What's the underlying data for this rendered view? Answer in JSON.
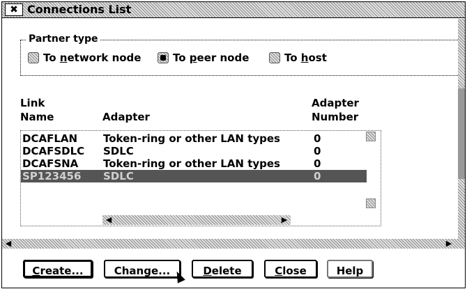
{
  "window": {
    "title": "Connections List",
    "sysmenu_glyph": "✖"
  },
  "partner_type": {
    "label": "Partner type",
    "options": [
      {
        "before": "To ",
        "ul": "n",
        "after": "etwork node",
        "selected": false
      },
      {
        "before": "To ",
        "ul": "p",
        "after": "eer node",
        "selected": true
      },
      {
        "before": "To ",
        "ul": "h",
        "after": "ost",
        "selected": false
      }
    ]
  },
  "columns": {
    "link_line1": "Link",
    "link_line2": "Name",
    "adapter": "Adapter",
    "adapter_num_line1": "Adapter",
    "adapter_num_line2": "Number"
  },
  "rows": [
    {
      "name": "DCAFLAN",
      "adapter": "Token-ring or other LAN types",
      "number": "0",
      "selected": false
    },
    {
      "name": "DCAFSDLC",
      "adapter": "SDLC",
      "number": "0",
      "selected": false
    },
    {
      "name": "DCAFSNA",
      "adapter": "Token-ring or other LAN types",
      "number": "0",
      "selected": false
    },
    {
      "name": "SP123456",
      "adapter": "SDLC",
      "number": "0",
      "selected": true
    }
  ],
  "buttons": {
    "create": {
      "ul": "C",
      "rest": "reate..."
    },
    "change": {
      "label": "Change..."
    },
    "delete": {
      "ul": "D",
      "rest": "elete"
    },
    "close": {
      "ul": "C",
      "rest": "lose"
    },
    "help": {
      "label": "Help"
    }
  },
  "colors": {
    "selection_bg": "#555555",
    "hatch": "#8c8c8c"
  }
}
